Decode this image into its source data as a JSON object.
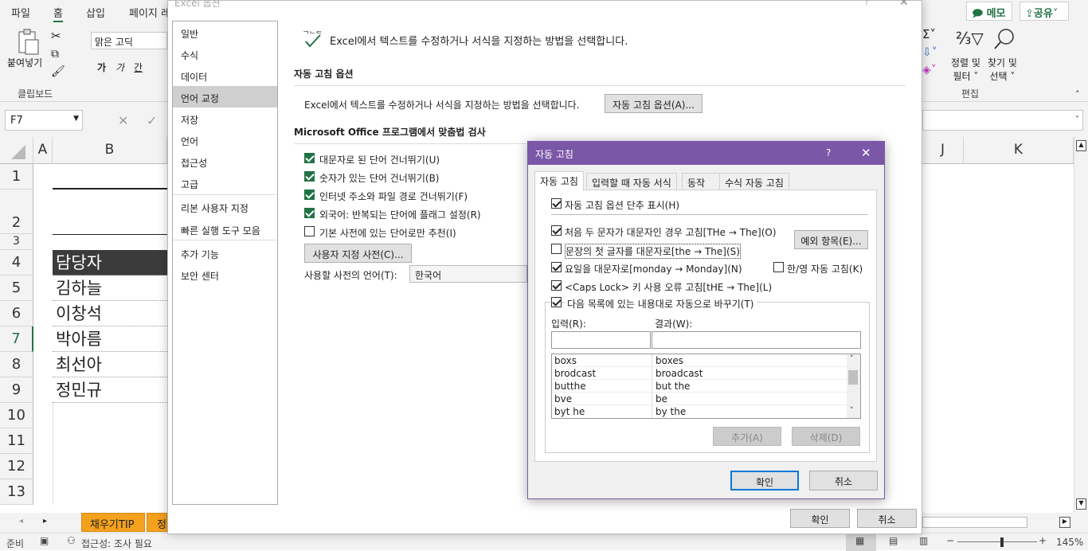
{
  "ribbon": {
    "tabs": [
      "파일",
      "홈",
      "삽입",
      "페이지 레"
    ],
    "memo_label": "메모",
    "share_label": "공유",
    "clipboard": {
      "paste_label": "붙여넣기",
      "group_label": "클립보드"
    },
    "font": {
      "name": "맑은 고딕",
      "bold": "가",
      "italic": "가",
      "underline": "간"
    },
    "editing": {
      "sort_label_1": "정렬 및",
      "sort_label_2": "필터",
      "find_label_1": "찾기 및",
      "find_label_2": "선택",
      "group_label": "편집"
    }
  },
  "formula": {
    "name_box": "F7"
  },
  "grid": {
    "columns_left": [
      "A",
      "B"
    ],
    "columns_right": [
      "J",
      "K"
    ],
    "rows": [
      "1",
      "2",
      "3",
      "4",
      "5",
      "6",
      "7",
      "8",
      "9",
      "10",
      "11",
      "12",
      "13"
    ],
    "cells": [
      "담당자",
      "김하늘",
      "이창석",
      "박아름",
      "최선아",
      "정민규"
    ]
  },
  "sheets": {
    "tab1": "채우기TIP",
    "tab2": "정"
  },
  "status": {
    "ready": "준비",
    "accessibility": "접근성: 조사 필요",
    "zoom": "145%"
  },
  "options": {
    "title": "Excel 옵션",
    "nav": [
      "일반",
      "수식",
      "데이터",
      "언어 교정",
      "저장",
      "언어",
      "접근성",
      "고급",
      "리본 사용자 지정",
      "빠른 실행 도구 모음",
      "추가 기능",
      "보안 센터"
    ],
    "header": "Excel에서 텍스트를 수정하거나 서식을 지정하는 방법을 선택합니다.",
    "autocorrect_section": "자동 고침 옵션",
    "autocorrect_desc": "Excel에서 텍스트를 수정하거나 서식을 지정하는 방법을 선택합니다.",
    "autocorrect_btn": "자동 고침 옵션(A)...",
    "spell_section": "Microsoft Office 프로그램에서 맞춤법 검사",
    "checks": [
      "대문자로 된 단어 건너뛰기(U)",
      "숫자가 있는 단어 건너뛰기(B)",
      "인터넷 주소와 파일 경로 건너뛰기(F)",
      "외국어: 반복되는 단어에 플래그 설정(R)",
      "기본 사전에 있는 단어로만 추천(I)"
    ],
    "custom_dict_btn": "사용자 지정 사전(C)...",
    "dict_lang_label": "사용할 사전의 언어(T):",
    "dict_lang_value": "한국어",
    "ok": "확인",
    "cancel": "취소"
  },
  "autocorrect": {
    "title": "자동 고침",
    "help": "?",
    "tabs": [
      "자동 고침",
      "입력할 때 자동 서식",
      "동작",
      "수식 자동 고침"
    ],
    "show_buttons": "자동 고침 옵션 단추 표시(H)",
    "two_initial": "처음 두 문자가 대문자인 경우 고침[THe → The](O)",
    "first_letter": "문장의 첫 글자를 대문자로[the → The](S)",
    "days": "요일을 대문자로[monday → Monday](N)",
    "capslock": "<Caps Lock> 키 사용 오류 고침[tHE → The](L)",
    "hanyoung": "한/영 자동 고침(K)",
    "exceptions_btn": "예외 항목(E)...",
    "replace_group": "다음 목록에 있는 내용대로 자동으로 바꾸기(T)",
    "input_label": "입력(R):",
    "result_label": "결과(W):",
    "entries": [
      {
        "input": "boxs",
        "result": "boxes"
      },
      {
        "input": "brodcast",
        "result": "broadcast"
      },
      {
        "input": "butthe",
        "result": "but the"
      },
      {
        "input": "bve",
        "result": "be"
      },
      {
        "input": "byt he",
        "result": "by the"
      }
    ],
    "add_btn": "추가(A)",
    "delete_btn": "삭제(D)",
    "ok": "확인",
    "cancel": "취소"
  }
}
